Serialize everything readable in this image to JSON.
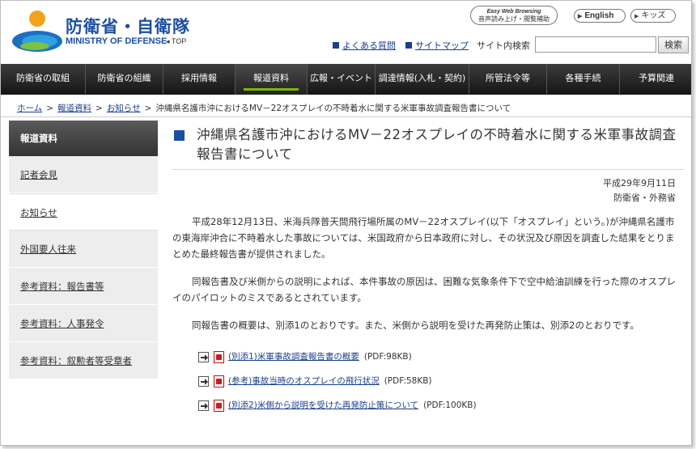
{
  "header": {
    "logo_jp": "防衛省・自衛隊",
    "logo_en": "MINISTRY OF DEFENSE",
    "top_link": "◂ TOP",
    "easy_web_en": "Easy Web Browsing",
    "easy_web_jp": "音声読み上げ・閲覧補助",
    "english_label": "English",
    "kids_label": "キッズ",
    "faq_label": "よくある質問",
    "sitemap_label": "サイトマップ",
    "search_label": "サイト内検索",
    "search_value": "",
    "search_button": "検索",
    "colors": {
      "brand_blue": "#1d4fa0",
      "link_blue": "#1a3f8f"
    }
  },
  "nav": {
    "items": [
      {
        "label": "防衛省の取組"
      },
      {
        "label": "防衛省の組織"
      },
      {
        "label": "採用情報"
      },
      {
        "label": "報道資料"
      },
      {
        "label": "広報・イベント"
      },
      {
        "label": "調達情報(入札・契約)"
      },
      {
        "label": "所管法令等"
      },
      {
        "label": "各種手続"
      },
      {
        "label": "予算関連"
      }
    ],
    "active_index": 3,
    "accent_color": "#7ab800"
  },
  "breadcrumb": {
    "home": "ホーム",
    "press": "報道資料",
    "notice": "お知らせ",
    "current": "沖縄県名護市沖におけるMV－22オスプレイの不時着水に関する米軍事故調査報告書について",
    "separator": ">"
  },
  "sidebar": {
    "heading": "報道資料",
    "items": [
      {
        "label": "記者会見"
      },
      {
        "label": "お知らせ"
      },
      {
        "label": "外国要人往来"
      },
      {
        "label": "参考資料：報告書等"
      },
      {
        "label": "参考資料：人事発令"
      },
      {
        "label": "参考資料：叙勲者等受章者"
      }
    ],
    "current_index": 1
  },
  "article": {
    "title": "沖縄県名護市沖におけるMV－22オスプレイの不時着水に関する米軍事故調査報告書について",
    "date": "平成29年9月11日",
    "issuer": "防衛省・外務省",
    "paragraphs": [
      "平成28年12月13日、米海兵隊普天間飛行場所属のMV－22オスプレイ(以下「オスプレイ」という。)が沖縄県名護市の東海岸沖合に不時着水した事故については、米国政府から日本政府に対し、その状況及び原因を調査した結果をとりまとめた最終報告書が提供されました。",
      "同報告書及び米側からの説明によれば、本件事故の原因は、困難な気象条件下で空中給油訓練を行った際のオスプレイのパイロットのミスであるとされています。",
      "同報告書の概要は、別添1のとおりです。また、米側から説明を受けた再発防止策は、別添2のとおりです。"
    ],
    "attachments": [
      {
        "label": "(別添1)米軍事故調査報告書の概要",
        "size": "(PDF:98KB)"
      },
      {
        "label": "(参考)事故当時のオスプレイの飛行状況",
        "size": "(PDF:58KB)"
      },
      {
        "label": "(別添2)米側から説明を受けた再発防止策について",
        "size": "(PDF:100KB)"
      }
    ]
  }
}
